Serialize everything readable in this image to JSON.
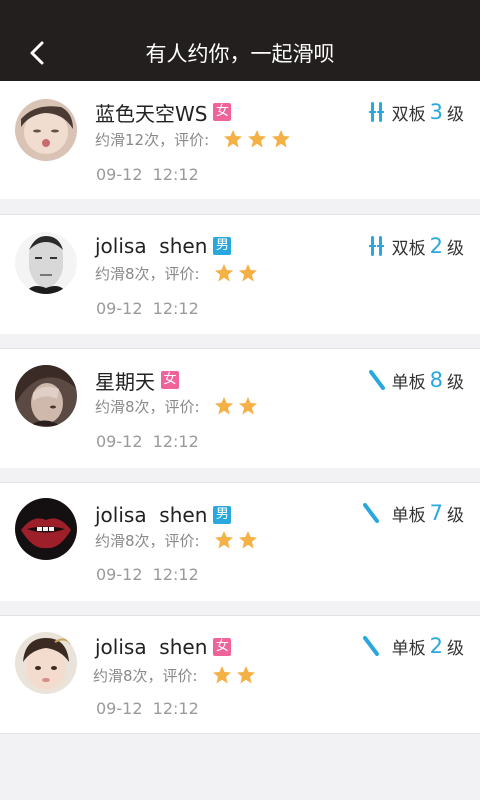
{
  "header": {
    "title": "有人约你，一起滑呗",
    "back_icon": "chevron-left-icon"
  },
  "colors": {
    "header_bg": "#231f1e",
    "accent": "#29a8e0",
    "female_badge": "#f0639a",
    "male_badge": "#29a8e0",
    "star": "#f5b046"
  },
  "requests": [
    {
      "name": "蓝色天空WS",
      "gender": "女",
      "gender_type": "female",
      "count_text": "约滑12次，评价:",
      "rating": 3,
      "time": "09-12  12:12",
      "board": "双板",
      "board_icon": "ski-icon",
      "level": "3",
      "level_unit": "级"
    },
    {
      "name": "jolisa  shen",
      "gender": "男",
      "gender_type": "male",
      "count_text": "约滑8次，评价:",
      "rating": 2,
      "time": "09-12  12:12",
      "board": "双板",
      "board_icon": "ski-icon",
      "level": "2",
      "level_unit": "级"
    },
    {
      "name": "星期天",
      "gender": "女",
      "gender_type": "female",
      "count_text": "约滑8次，评价:",
      "rating": 2,
      "time": "09-12  12:12",
      "board": "单板",
      "board_icon": "snowboard-icon",
      "level": "8",
      "level_unit": "级"
    },
    {
      "name": "jolisa  shen",
      "gender": "男",
      "gender_type": "male",
      "count_text": "约滑8次，评价:",
      "rating": 2,
      "time": "09-12  12:12",
      "board": "单板",
      "board_icon": "snowboard-icon",
      "level": "7",
      "level_unit": "级"
    },
    {
      "name": "jolisa  shen",
      "gender": "女",
      "gender_type": "female",
      "count_text": "约滑8次，评价:",
      "rating": 2,
      "time": "09-12  12:12",
      "board": "单板",
      "board_icon": "snowboard-icon",
      "level": "2",
      "level_unit": "级"
    }
  ]
}
